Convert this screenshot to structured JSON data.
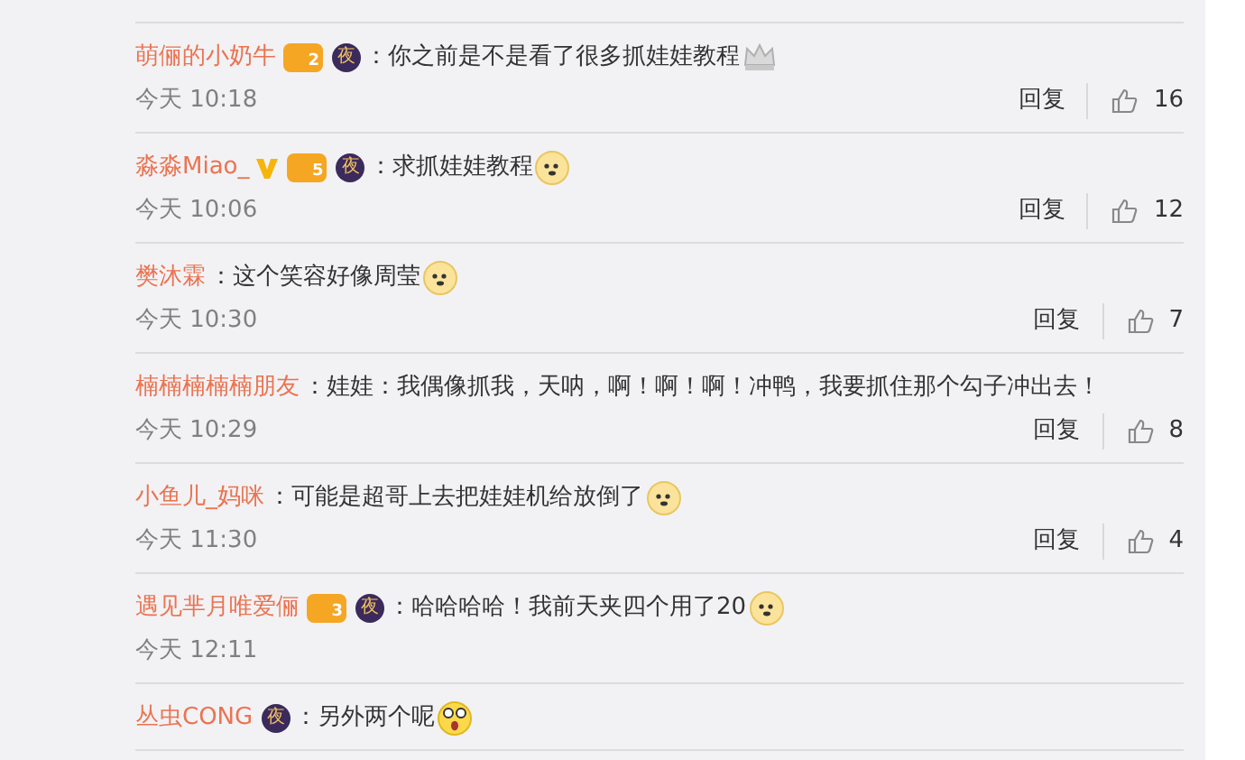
{
  "comments": [
    {
      "user": "萌俪的小奶牛",
      "badges": [
        {
          "kind": "vip",
          "text": "2"
        },
        {
          "kind": "night",
          "text": "夜"
        }
      ],
      "text": "：你之前是不是看了很多抓娃娃教程",
      "emoji": {
        "kind": "crown"
      },
      "time": "今天 10:18",
      "reply": "回复",
      "likes": "16"
    },
    {
      "user": "淼淼Miao_",
      "badges": [
        {
          "kind": "verified"
        },
        {
          "kind": "vip",
          "text": "5"
        },
        {
          "kind": "night",
          "text": "夜"
        }
      ],
      "text": "：求抓娃娃教程",
      "emoji": {
        "kind": "doge"
      },
      "time": "今天 10:06",
      "reply": "回复",
      "likes": "12"
    },
    {
      "user": "樊沐霖",
      "text": "：这个笑容好像周莹",
      "emoji": {
        "kind": "doge"
      },
      "time": "今天 10:30",
      "reply": "回复",
      "likes": "7"
    },
    {
      "user": "楠楠楠楠楠朋友",
      "text": "：娃娃：我偶像抓我，天呐，啊！啊！啊！冲鸭，我要抓住那个勾子冲出去！",
      "time": "今天 10:29",
      "reply": "回复",
      "likes": "8"
    },
    {
      "user": "小鱼儿_妈咪",
      "text": "：可能是超哥上去把娃娃机给放倒了",
      "emoji": {
        "kind": "doge"
      },
      "time": "今天 11:30",
      "reply": "回复",
      "likes": "4"
    },
    {
      "user": "遇见芈月唯爱俪",
      "badges": [
        {
          "kind": "vip",
          "text": "3"
        },
        {
          "kind": "night",
          "text": "夜"
        }
      ],
      "text": "：哈哈哈哈！我前天夹四个用了20",
      "emoji": {
        "kind": "doge"
      },
      "time": "今天 12:11"
    },
    {
      "user": "丛虫CONG",
      "badges": [
        {
          "kind": "night",
          "text": "夜"
        }
      ],
      "text": "：另外两个呢",
      "emoji": {
        "kind": "surprised"
      }
    }
  ]
}
